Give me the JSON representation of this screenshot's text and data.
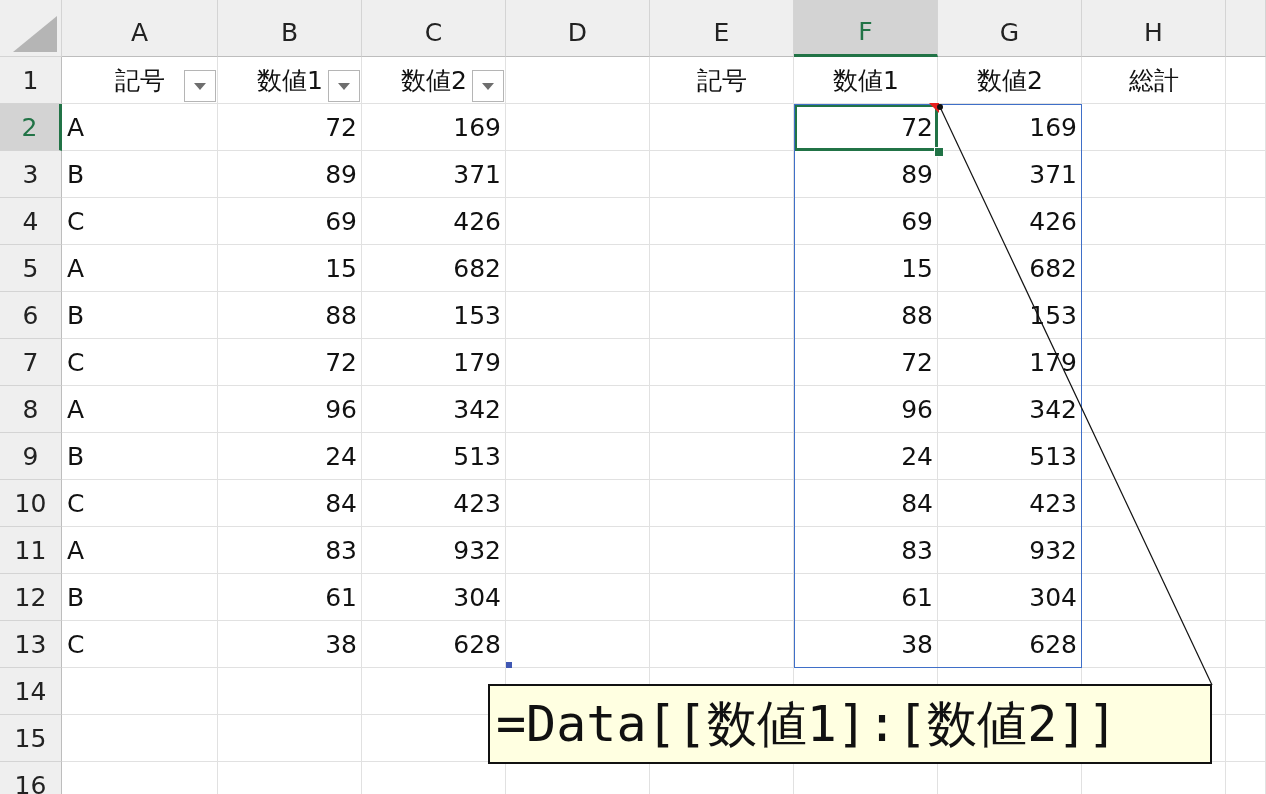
{
  "columns": [
    {
      "label": "A",
      "selected": false
    },
    {
      "label": "B",
      "selected": false
    },
    {
      "label": "C",
      "selected": false
    },
    {
      "label": "D",
      "selected": false
    },
    {
      "label": "E",
      "selected": false
    },
    {
      "label": "F",
      "selected": true
    },
    {
      "label": "G",
      "selected": false
    },
    {
      "label": "H",
      "selected": false
    }
  ],
  "rows": [
    {
      "label": "1",
      "selected": false
    },
    {
      "label": "2",
      "selected": true
    },
    {
      "label": "3",
      "selected": false
    },
    {
      "label": "4",
      "selected": false
    },
    {
      "label": "5",
      "selected": false
    },
    {
      "label": "6",
      "selected": false
    },
    {
      "label": "7",
      "selected": false
    },
    {
      "label": "8",
      "selected": false
    },
    {
      "label": "9",
      "selected": false
    },
    {
      "label": "10",
      "selected": false
    },
    {
      "label": "11",
      "selected": false
    },
    {
      "label": "12",
      "selected": false
    },
    {
      "label": "13",
      "selected": false
    },
    {
      "label": "14",
      "selected": false
    },
    {
      "label": "15",
      "selected": false
    },
    {
      "label": "16",
      "selected": false
    }
  ],
  "table_header": [
    "記号",
    "数値1",
    "数値2"
  ],
  "table_rows": [
    {
      "symbol": "A",
      "value_1": "72",
      "value_2": "169"
    },
    {
      "symbol": "B",
      "value_1": "89",
      "value_2": "371"
    },
    {
      "symbol": "C",
      "value_1": "69",
      "value_2": "426"
    },
    {
      "symbol": "A",
      "value_1": "15",
      "value_2": "682"
    },
    {
      "symbol": "B",
      "value_1": "88",
      "value_2": "153"
    },
    {
      "symbol": "C",
      "value_1": "72",
      "value_2": "179"
    },
    {
      "symbol": "A",
      "value_1": "96",
      "value_2": "342"
    },
    {
      "symbol": "B",
      "value_1": "24",
      "value_2": "513"
    },
    {
      "symbol": "C",
      "value_1": "84",
      "value_2": "423"
    },
    {
      "symbol": "A",
      "value_1": "83",
      "value_2": "932"
    },
    {
      "symbol": "B",
      "value_1": "61",
      "value_2": "304"
    },
    {
      "symbol": "C",
      "value_1": "38",
      "value_2": "628"
    }
  ],
  "result_header": [
    "記号",
    "数値1",
    "数値2",
    "総計"
  ],
  "result_rows": [
    {
      "value_1": "72",
      "value_2": "169",
      "active": true
    },
    {
      "value_1": "89",
      "value_2": "371",
      "active": false
    },
    {
      "value_1": "69",
      "value_2": "426",
      "active": false
    },
    {
      "value_1": "15",
      "value_2": "682",
      "active": false
    },
    {
      "value_1": "88",
      "value_2": "153",
      "active": false
    },
    {
      "value_1": "72",
      "value_2": "179",
      "active": false
    },
    {
      "value_1": "96",
      "value_2": "342",
      "active": false
    },
    {
      "value_1": "24",
      "value_2": "513",
      "active": false
    },
    {
      "value_1": "84",
      "value_2": "423",
      "active": false
    },
    {
      "value_1": "83",
      "value_2": "932",
      "active": false
    },
    {
      "value_1": "61",
      "value_2": "304",
      "active": false
    },
    {
      "value_1": "38",
      "value_2": "628",
      "active": false
    }
  ],
  "comment": {
    "text": "=Data[[数値1]:[数値2]]"
  }
}
